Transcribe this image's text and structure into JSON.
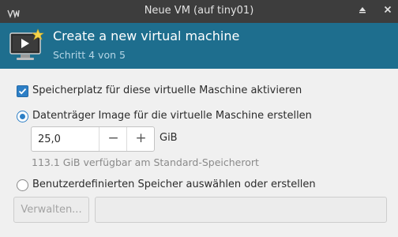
{
  "window": {
    "title": "Neue VM (auf tiny01)",
    "app_icon": "app-menu-icon",
    "controls": {
      "minimize_icon": "minimize-icon",
      "maximize_icon": "maximize-icon",
      "close_icon": "close-icon"
    }
  },
  "header": {
    "title": "Create a new virtual machine",
    "subtitle": "Schritt 4 von 5",
    "icon": "new-vm-icon",
    "background": "#1e6e8e"
  },
  "storage": {
    "enable_label": "Speicherplatz für diese virtuelle Maschine aktivieren",
    "enable_checked": true,
    "create_image_label": "Datenträger Image für die virtuelle Maschine erstellen",
    "create_image_selected": true,
    "size_value": "25,0",
    "decrement_symbol": "−",
    "increment_symbol": "+",
    "size_unit": "GiB",
    "available_hint": "113.1 GiB verfügbar am Standard-Speicherort",
    "custom_label": "Benutzerdefinierten Speicher auswählen oder erstellen",
    "custom_selected": false,
    "browse_label": "Verwalten...",
    "path_value": ""
  },
  "colors": {
    "accent": "#2d7fc6",
    "titlebar": "#3d3d3d",
    "window_bg": "#f0f0f0"
  }
}
